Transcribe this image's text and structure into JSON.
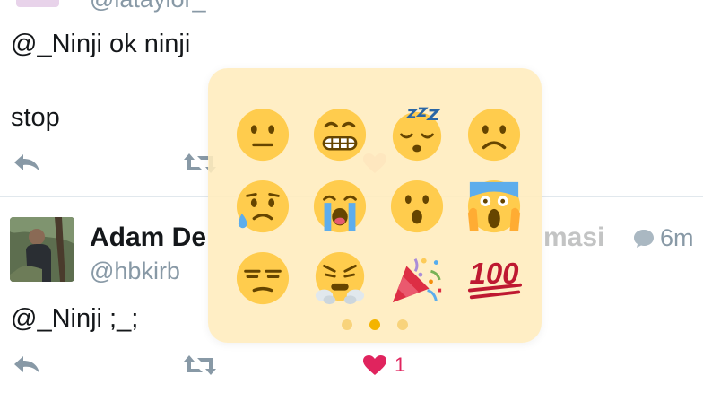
{
  "tweet1": {
    "handle_partial": "@lataylor_",
    "line1": "@_Ninji ok ninji",
    "line2": "stop"
  },
  "tweet2": {
    "name_visible_left": "Adam De",
    "name_visible_right": "masi",
    "handle": "@hbkirb",
    "text": "@_Ninji ;_;",
    "time": "6m",
    "like_count": "1"
  },
  "emoji_picker": {
    "emojis": [
      "neutral-face",
      "grimacing-face",
      "sleeping-face",
      "frowning-face",
      "sad-relieved-face",
      "loudly-crying-face",
      "hushed-face",
      "screaming-face",
      "unamused-face",
      "triumph-face",
      "party-popper",
      "hundred-points"
    ],
    "pages": 3,
    "active_page": 2,
    "hundred_label": "100"
  },
  "colors": {
    "icon_gray": "#8899a6",
    "like_red": "#e0245e",
    "picker_bg": "#ffecbd",
    "emoji_yellow": "#ffcc4d"
  }
}
